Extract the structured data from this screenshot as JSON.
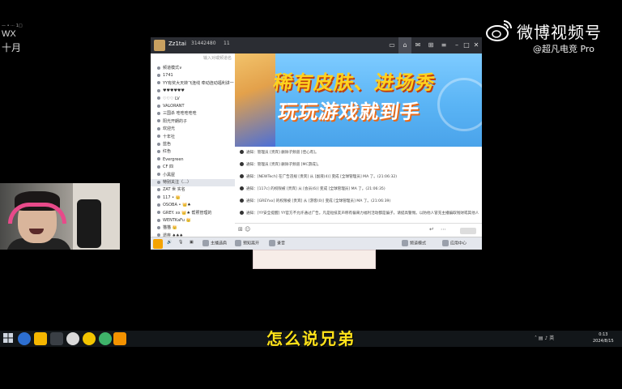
{
  "overlay": {
    "small_text": "— • ⋯ 1□",
    "top_left_line1": "WX",
    "top_left_line2": "十月"
  },
  "watermark": {
    "title": "微博视频号",
    "handle": "@超凡电竞 Pro"
  },
  "app": {
    "titlebar": {
      "name": "Zz1tai",
      "id": "31442480",
      "count": "11"
    },
    "sidebar": {
      "search_placeholder": "输入对或频道名",
      "items": [
        {
          "label": "频道模式∨"
        },
        {
          "label": "1741"
        },
        {
          "label": "YY有奖大天转飞连线  牵动连动福利讲一"
        },
        {
          "label": "♥♥♥♥♥♥"
        },
        {
          "label": "♡♡♡ LV"
        },
        {
          "label": "VALORANT"
        },
        {
          "label": "三国杀 哇哇哇哇哇"
        },
        {
          "label": "阳光开朗的子"
        },
        {
          "label": "欢迎光"
        },
        {
          "label": "十年社"
        },
        {
          "label": "蓝色"
        },
        {
          "label": "红色"
        },
        {
          "label": "Evergreen"
        },
        {
          "label": "CF 四"
        },
        {
          "label": "小黑屋"
        },
        {
          "label": "特别关注（…）"
        },
        {
          "label": "ZAT 世 实名"
        },
        {
          "label": "117 • 👑"
        },
        {
          "label": "OSOBA • 👑♠"
        },
        {
          "label": "GREY. xx 👑♠  帮照管理的"
        },
        {
          "label": "WENTKaFu 👑"
        },
        {
          "label": "猫猫 👑"
        },
        {
          "label": "遗弃 ♠♠♠"
        }
      ]
    },
    "banner": {
      "line1": "稀有皮肤、进场秀",
      "line2": "玩玩游戏就到手"
    },
    "chat": [
      {
        "text": "通知：管理员 [贵宾] 删除子频道 [佳心有]。"
      },
      {
        "text": "通知：管理员 [贵宾] 删除子频道 [MC游成]。"
      },
      {
        "text": "通知：[NEWTech] 在广告违规 [贵宾] 从 [副液(4)] 变成 [全球管理员] MA 了。(21:06:32)"
      },
      {
        "text": "通知：[117c] 的权限被 [贵宾] 从 [会员(6)] 变成 [全球管理员] MA 了。(21:06:35)"
      },
      {
        "text": "通知：[GREYxx] 的权限被 [贵宾] 从 [游客(0)] 变成 [全球管理员] MA 了。(21:06:39)"
      },
      {
        "text": "通知：[YY安全提醒] YY官方不允许通过广告。凡是短技友声称有偏来力福利活动都是骗子。请提高警惕。以防他人冒充主播骗取钱财或其他人员地行骗。"
      }
    ],
    "bottombar": {
      "item1": "主播选肩",
      "item2": "预知离开",
      "item3": "录音",
      "item4": "频道模式",
      "item5": "应用中心"
    }
  },
  "subtitle": "怎么说兄弟",
  "taskbar": {
    "clock_time": "0:13",
    "clock_date": "2024/8/15",
    "tray_text": "˄ ▤ ♪ 英"
  }
}
